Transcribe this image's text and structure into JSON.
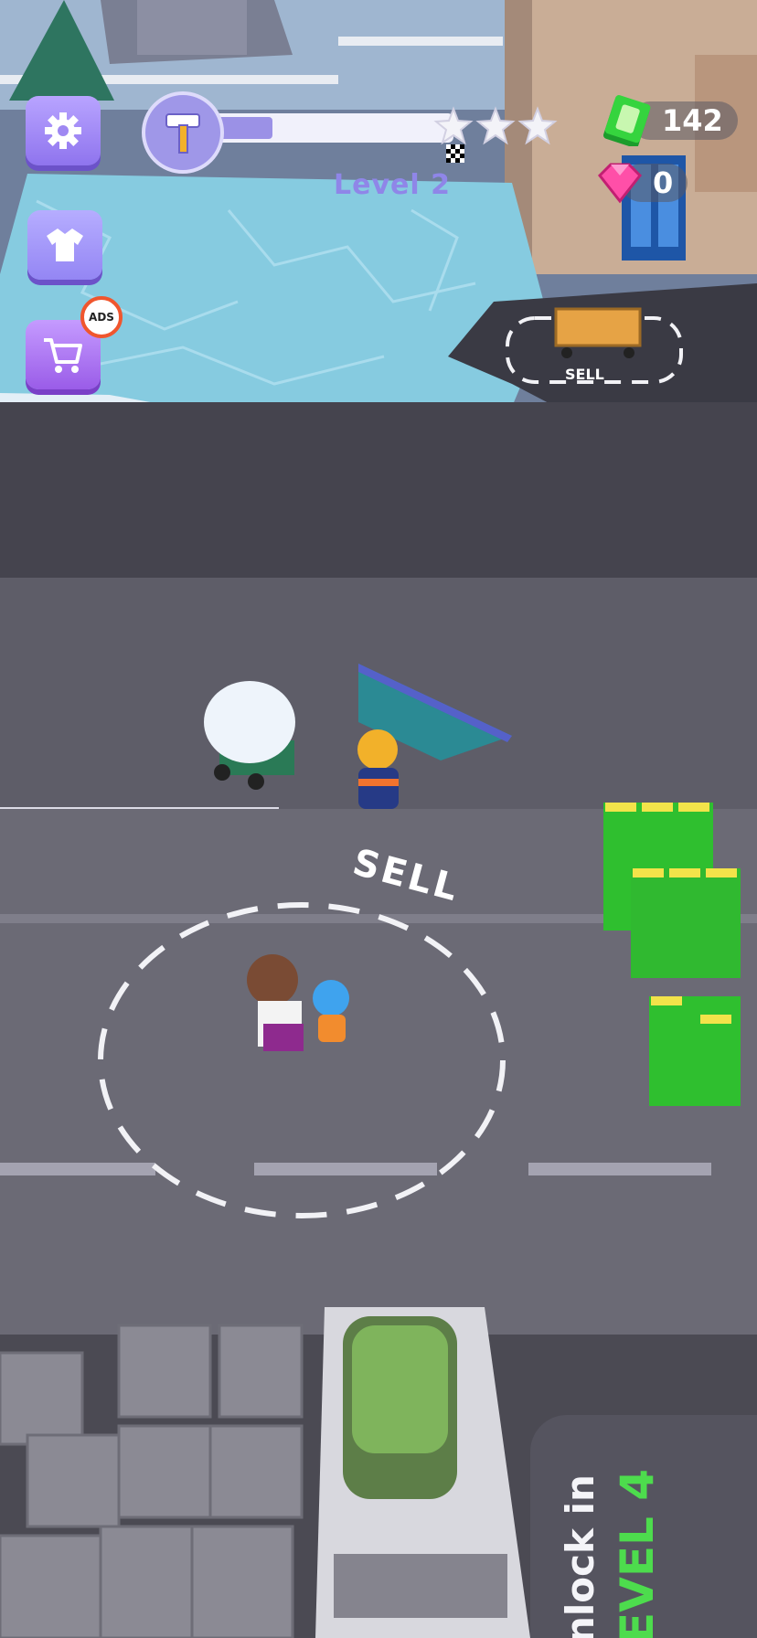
{
  "hud": {
    "settings_icon": "gear-icon",
    "shirt_icon": "shirt-icon",
    "shop_icon": "cart-icon",
    "no_ads_badge": "ADS",
    "tool_icon": "hammer-icon",
    "level_label": "Level 2",
    "level_progress": 0.26,
    "stars_total": 3,
    "stars_filled": 0,
    "cash_amount": "142",
    "gem_amount": "0"
  },
  "world": {
    "sell_label_small": "SELL",
    "sell_label_big": "SELL",
    "unlock_line1": "nlock in",
    "unlock_line2": "EVEL 4"
  },
  "colors": {
    "accent": "#9b8cf2",
    "cash_green": "#2fbf2f",
    "gem_pink": "#ff4fa8",
    "unlock_green": "#4ddc4d"
  }
}
